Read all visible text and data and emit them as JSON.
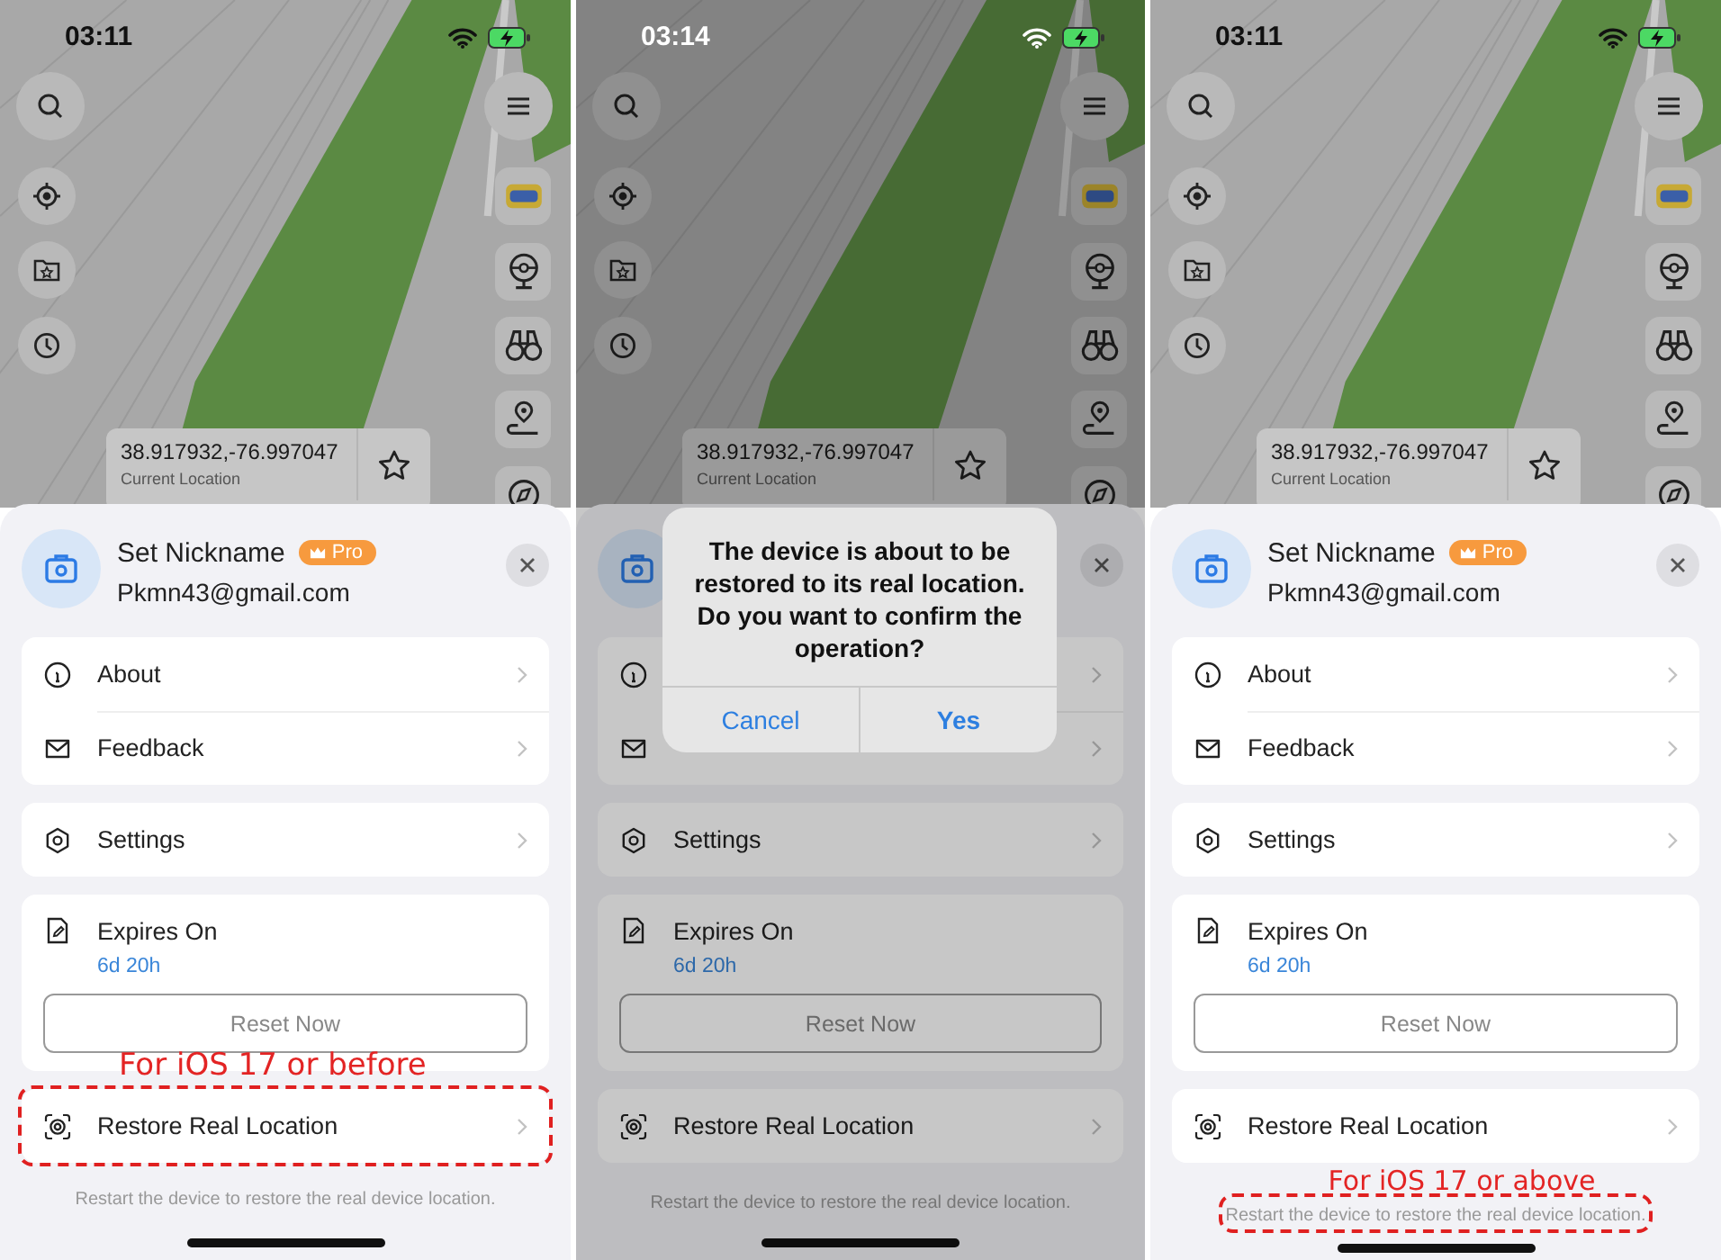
{
  "panels": [
    {
      "status_bar": {
        "time": "03:11"
      },
      "location": {
        "coords": "38.917932,-76.997047",
        "label": "Current Location"
      },
      "profile": {
        "name": "Set Nickname",
        "badge": "Pro",
        "email": "Pkmn43@gmail.com"
      },
      "menu_groups": [
        [
          {
            "kind": "info",
            "label": "About"
          },
          {
            "kind": "mail",
            "label": "Feedback"
          }
        ],
        [
          {
            "kind": "settings",
            "label": "Settings"
          }
        ]
      ],
      "subscription": {
        "title": "Expires On",
        "value": "6d 20h",
        "button": "Reset Now"
      },
      "restore": {
        "label": "Restore Real Location"
      },
      "footnote": "Restart the device to restore the real device location.",
      "annotation": {
        "kind": "restore",
        "text": "For iOS 17 or before"
      }
    },
    {
      "status_bar": {
        "time": "03:14"
      },
      "location": {
        "coords": "38.917932,-76.997047",
        "label": "Current Location"
      },
      "menu_groups": [
        [
          {
            "kind": "info"
          },
          {
            "kind": "mail"
          }
        ],
        [
          {
            "kind": "settings",
            "label": "Settings"
          }
        ]
      ],
      "subscription": {
        "title": "Expires On",
        "value": "6d 20h",
        "button": "Reset Now"
      },
      "restore": {
        "label": "Restore Real Location"
      },
      "footnote": "Restart the device to restore the real device location.",
      "dialog": {
        "message": "The device is about to be restored to its real location. Do you want to confirm the operation?",
        "buttons": [
          {
            "label": "Cancel",
            "bold": false
          },
          {
            "label": "Yes",
            "bold": true
          }
        ]
      }
    },
    {
      "status_bar": {
        "time": "03:11"
      },
      "location": {
        "coords": "38.917932,-76.997047",
        "label": "Current Location"
      },
      "profile": {
        "name": "Set Nickname",
        "badge": "Pro",
        "email": "Pkmn43@gmail.com"
      },
      "menu_groups": [
        [
          {
            "kind": "info",
            "label": "About"
          },
          {
            "kind": "mail",
            "label": "Feedback"
          }
        ],
        [
          {
            "kind": "settings",
            "label": "Settings"
          }
        ]
      ],
      "subscription": {
        "title": "Expires On",
        "value": "6d 20h",
        "button": "Reset Now"
      },
      "restore": {
        "label": "Restore Real Location"
      },
      "footnote": "Restart the device to restore the real device location.",
      "annotation": {
        "kind": "footnote",
        "text": "For iOS 17 or above"
      }
    }
  ]
}
